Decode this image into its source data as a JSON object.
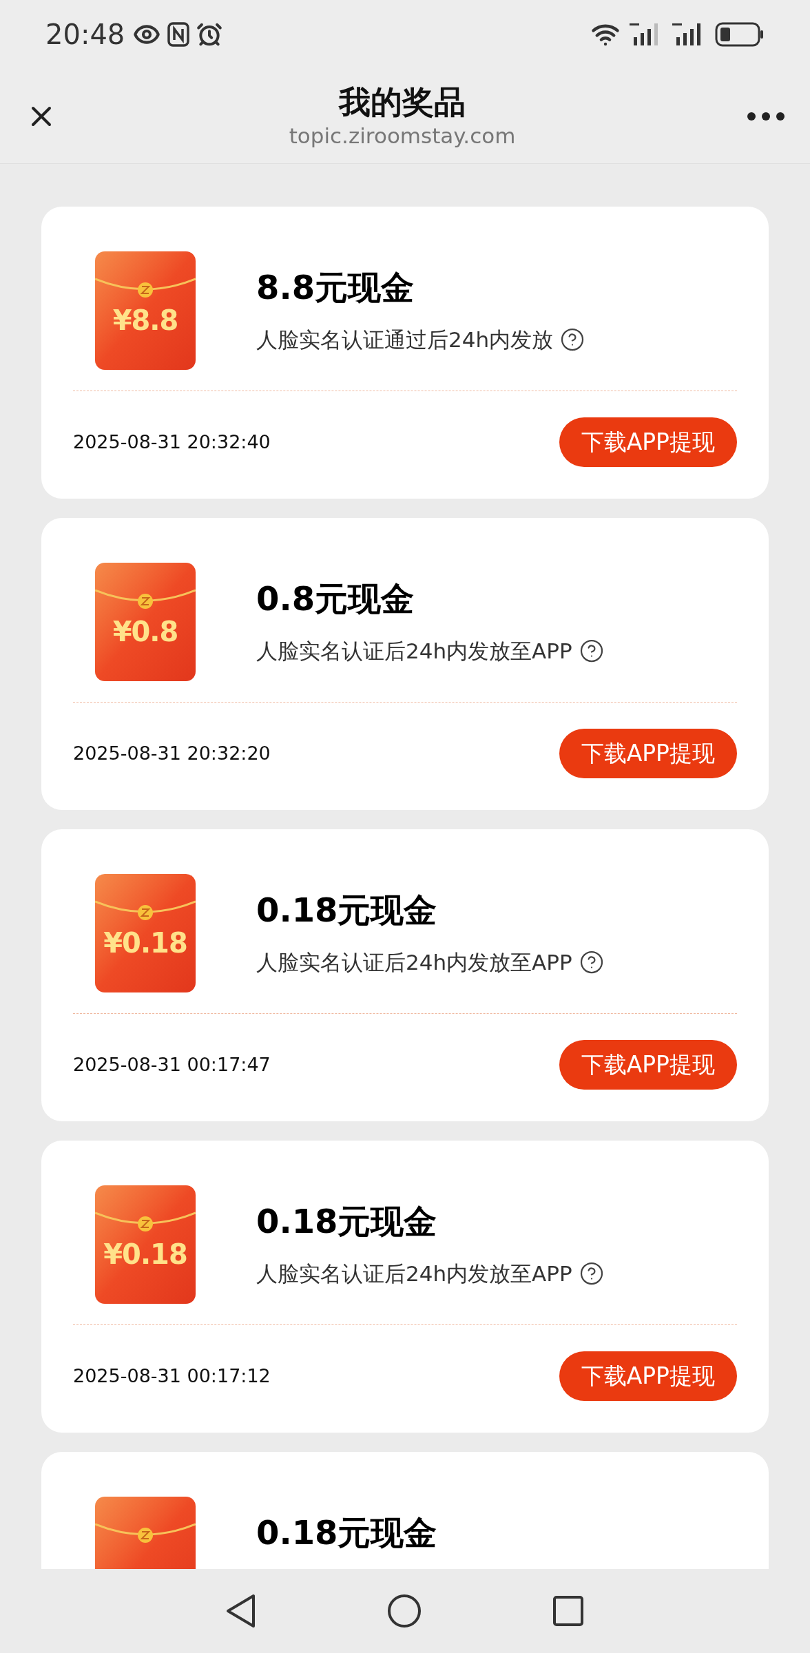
{
  "status_bar": {
    "time": "20:48"
  },
  "header": {
    "title": "我的奖品",
    "url": "topic.ziroomstay.com"
  },
  "prizes": [
    {
      "icon_amount": "¥8.8",
      "title": "8.8元现金",
      "description": "人脸实名认证通过后24h内发放",
      "time": "2025-08-31 20:32:40",
      "button": "下载APP提现"
    },
    {
      "icon_amount": "¥0.8",
      "title": "0.8元现金",
      "description": "人脸实名认证后24h内发放至APP",
      "time": "2025-08-31 20:32:20",
      "button": "下载APP提现"
    },
    {
      "icon_amount": "¥0.18",
      "title": "0.18元现金",
      "description": "人脸实名认证后24h内发放至APP",
      "time": "2025-08-31 00:17:47",
      "button": "下载APP提现"
    },
    {
      "icon_amount": "¥0.18",
      "title": "0.18元现金",
      "description": "人脸实名认证后24h内发放至APP",
      "time": "2025-08-31 00:17:12",
      "button": "下载APP提现"
    },
    {
      "title": "0.18元现金"
    }
  ]
}
